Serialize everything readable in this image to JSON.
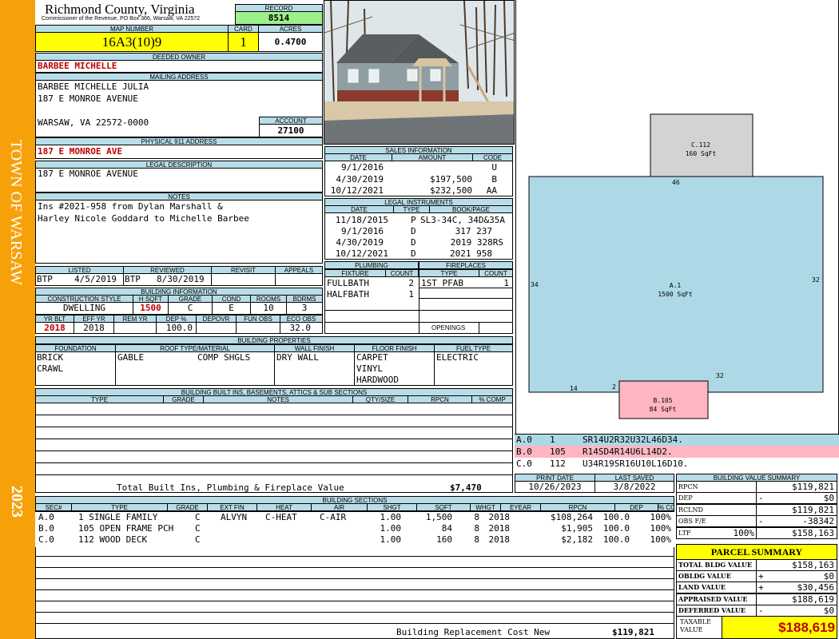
{
  "side_band": {
    "town": "TOWN OF WARSAW",
    "year": "2023"
  },
  "header": {
    "county": "Richmond County, Virginia",
    "commissioner": "Commissioner of the Revenue, PO Box 366, Warsaw, VA 22572",
    "record_label": "RECORD",
    "record": "8514",
    "map_label": "MAP NUMBER",
    "map_number": "16A3(10)9",
    "card_label": "CARD",
    "card": "1",
    "acres_label": "ACRES",
    "acres": "0.4700"
  },
  "owner": {
    "deeded_label": "DEEDED OWNER",
    "deeded_owner": "BARBEE MICHELLE",
    "mailing_label": "MAILING ADDRESS",
    "mailing": [
      "BARBEE MICHELLE JULIA",
      "187 E MONROE AVENUE",
      "",
      "WARSAW, VA 22572-0000"
    ],
    "account_label": "ACCOUNT",
    "account": "27100",
    "phys_label": "PHYSICAL 911 ADDRESS",
    "physical": "187 E MONROE AVE",
    "legal_label": "LEGAL DESCRIPTION",
    "legal": "187 E MONROE AVENUE",
    "notes_label": "NOTES",
    "notes": [
      "Ins #2021-958 from Dylan Marshall &",
      "Harley Nicole Goddard to Michelle Barbee"
    ]
  },
  "sales": {
    "title": "SALES INFORMATION",
    "headers": [
      "DATE",
      "AMOUNT",
      "CODE"
    ],
    "rows": [
      [
        "9/1/2016",
        "",
        "U"
      ],
      [
        "4/30/2019",
        "$197,500",
        "B"
      ],
      [
        "10/12/2021",
        "$232,500",
        "AA"
      ]
    ]
  },
  "legal_instruments": {
    "title": "LEGAL INSTRUMENTS",
    "headers": [
      "DATE",
      "TYPE",
      "BOOK/PAGE"
    ],
    "rows": [
      [
        "11/18/2015",
        "P",
        "SL3-34C, 34D&35A"
      ],
      [
        "9/1/2016",
        "D",
        "317 237"
      ],
      [
        "4/30/2019",
        "D",
        "2019 328RS"
      ],
      [
        "10/12/2021",
        "D",
        "2021 958"
      ]
    ]
  },
  "review": {
    "headers": [
      "LISTED",
      "REVIEWED",
      "REVISIT",
      "APPEALS"
    ],
    "listed": [
      "BTP",
      "4/5/2019"
    ],
    "reviewed": [
      "BTP",
      "8/30/2019"
    ],
    "revisit": "",
    "appeals": ""
  },
  "building_info": {
    "title": "BUILDING INFORMATION",
    "headers1": [
      "CONSTRUCTION STYLE",
      "H SQFT",
      "GRADE",
      "COND",
      "ROOMS",
      "BDRMS"
    ],
    "row1": [
      "DWELLING",
      "1500",
      "C",
      "E",
      "10",
      "3"
    ],
    "headers2": [
      "YR BLT",
      "EFF YR",
      "REM YR",
      "DEP %",
      "DEPOVR",
      "FUN OBS",
      "ECO OBS"
    ],
    "row2": [
      "2018",
      "2018",
      "",
      "100.0",
      "",
      "",
      "32.0"
    ]
  },
  "plumbing": {
    "title": "PLUMBING",
    "headers": [
      "FIXTURE",
      "COUNT"
    ],
    "rows": [
      [
        "FULLBATH",
        "2"
      ],
      [
        "HALFBATH",
        "1"
      ]
    ]
  },
  "fireplaces": {
    "title": "FIREPLACES",
    "headers": [
      "TYPE",
      "COUNT"
    ],
    "rows": [
      [
        "1ST PFAB",
        "1"
      ]
    ],
    "openings_label": "OPENINGS"
  },
  "building_props": {
    "title": "BUILDING PROPERTIES",
    "headers": [
      "FOUNDATION",
      "ROOF TYPE/MATERIAL",
      "WALL FINISH",
      "FLOOR FINISH",
      "FUEL TYPE"
    ],
    "foundation": [
      "BRICK",
      "CRAWL"
    ],
    "roof_type": "GABLE",
    "roof_material": "COMP SHGLS",
    "wall": "DRY WALL",
    "floor": [
      "CARPET",
      "VINYL",
      "HARDWOOD"
    ],
    "fuel": "ELECTRIC"
  },
  "builtins": {
    "title": "BUILDING BUILT INS, BASEMENTS, ATTICS & SUB SECTIONS",
    "headers": [
      "TYPE",
      "GRADE",
      "NOTES",
      "QTY/SIZE",
      "RPCN",
      "% COMP"
    ],
    "total_label": "Total Built Ins, Plumbing & Fireplace Value",
    "total": "$7,470"
  },
  "sketch": {
    "sections": [
      {
        "code": "C.112",
        "area": "160 SqFt"
      },
      {
        "code": "A.1",
        "area": "1500 SqFt"
      },
      {
        "code": "B.105",
        "area": "84 SqFt"
      }
    ],
    "dims": [
      "46",
      "34",
      "32",
      "32",
      "14",
      "2"
    ],
    "legend": [
      {
        "sec": "A.0",
        "code": "1",
        "path": "SR14U2R32U32L46D34.",
        "color": "#add8e6"
      },
      {
        "sec": "B.0",
        "code": "105",
        "path": "R14SD4R14U6L14D2.",
        "color": "#ffb6c1"
      },
      {
        "sec": "C.0",
        "code": "112",
        "path": "U34R19SR16U10L16D10.",
        "color": "#d3d3d3"
      }
    ]
  },
  "print": {
    "headers": [
      "PRINT DATE",
      "LAST SAVED"
    ],
    "values": [
      "10/26/2023",
      "3/8/2022"
    ]
  },
  "sections": {
    "title": "BUILDING SECTIONS",
    "headers": [
      "SEC#",
      "TYPE",
      "GRADE",
      "EXT FIN",
      "HEAT",
      "AIR",
      "SHGT",
      "SQFT",
      "WHGT",
      "EYEAR",
      "RPCN",
      "DEP",
      "% COMP"
    ],
    "rows": [
      [
        "A.0",
        "1 SINGLE FAMILY",
        "C",
        "ALVYN",
        "C-HEAT",
        "C-AIR",
        "1.00",
        "1,500",
        "8",
        "2018",
        "$108,264",
        "100.0",
        "100%"
      ],
      [
        "B.0",
        "105 OPEN FRAME PCH",
        "C",
        "",
        "",
        "",
        "1.00",
        "84",
        "8",
        "2018",
        "$1,905",
        "100.0",
        "100%"
      ],
      [
        "C.0",
        "112 WOOD DECK",
        "C",
        "",
        "",
        "",
        "1.00",
        "160",
        "8",
        "2018",
        "$2,182",
        "100.0",
        "100%"
      ]
    ],
    "repl_label": "Building Replacement Cost New",
    "repl": "$119,821"
  },
  "value_summary": {
    "title": "BUILDING VALUE SUMMARY",
    "rows": [
      {
        "label": "RPCN",
        "mid": "",
        "sign": "",
        "value": "$119,821"
      },
      {
        "label": "DEP",
        "mid": "",
        "sign": "-",
        "value": "$0"
      },
      {
        "label": "RCLND",
        "mid": "",
        "sign": "",
        "value": "$119,821"
      },
      {
        "label": "OBS F/E",
        "mid": "",
        "sign": "-",
        "value": "-38342"
      },
      {
        "label": "LTF",
        "mid": "100%",
        "sign": "",
        "value": "$158,163"
      }
    ]
  },
  "parcel": {
    "title": "PARCEL SUMMARY",
    "rows": [
      {
        "label": "TOTAL BLDG VALUE",
        "sign": "",
        "value": "$158,163"
      },
      {
        "label": "OBLDG VALUE",
        "sign": "+",
        "value": "$0"
      },
      {
        "label": "LAND VALUE",
        "sign": "+",
        "value": "$30,456"
      },
      {
        "label": "APPRAISED VALUE",
        "sign": "",
        "value": "$188,619"
      },
      {
        "label": "DEFERRED VALUE",
        "sign": "-",
        "value": "$0"
      }
    ],
    "taxable_label": [
      "TAXABLE",
      "VALUE"
    ],
    "taxable": "$188,619"
  },
  "colors": {
    "band": "#f7a10a",
    "header": "#b9dde8",
    "yellow": "#ffff00",
    "green": "#9ef08a",
    "red": "#c00000"
  }
}
